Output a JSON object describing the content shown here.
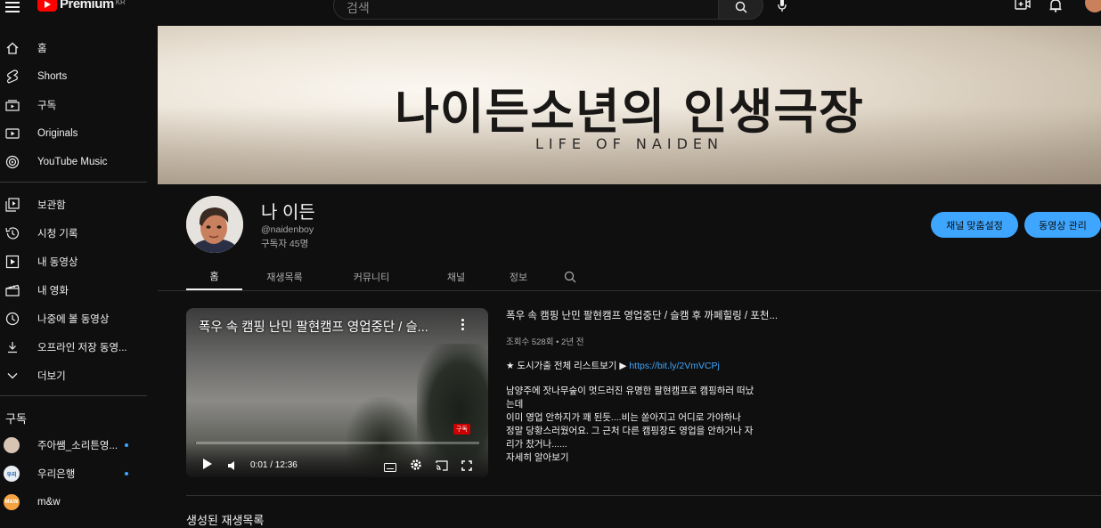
{
  "header": {
    "logo_text": "Premium",
    "logo_sup": "KR",
    "search_placeholder": "검색"
  },
  "sidebar": {
    "primary": [
      {
        "label": "홈",
        "icon": "home-icon"
      },
      {
        "label": "Shorts",
        "icon": "shorts-icon"
      },
      {
        "label": "구독",
        "icon": "subscriptions-icon"
      },
      {
        "label": "Originals",
        "icon": "originals-icon"
      },
      {
        "label": "YouTube Music",
        "icon": "music-icon"
      }
    ],
    "secondary": [
      {
        "label": "보관함",
        "icon": "library-icon"
      },
      {
        "label": "시청 기록",
        "icon": "history-icon"
      },
      {
        "label": "내 동영상",
        "icon": "my-videos-icon"
      },
      {
        "label": "내 영화",
        "icon": "movies-icon"
      },
      {
        "label": "나중에 볼 동영상",
        "icon": "watch-later-icon"
      },
      {
        "label": "오프라인 저장 동영...",
        "icon": "download-icon"
      },
      {
        "label": "더보기",
        "icon": "chevron-down-icon"
      }
    ],
    "subs_heading": "구독",
    "subscriptions": [
      {
        "label": "주아쌤_소리튼영...",
        "badge": "",
        "color": "#d8c4b2",
        "new": true
      },
      {
        "label": "우리은행",
        "badge": "우리",
        "color": "#e9eef5",
        "new": true
      },
      {
        "label": "m&w",
        "badge": "M&W",
        "color": "#f4a340",
        "new": false
      }
    ]
  },
  "banner": {
    "title": "나이든소년의 인생극장",
    "subtitle": "LIFE OF NAIDEN"
  },
  "channel": {
    "name": "나 이든",
    "handle": "@naidenboy",
    "subscribers": "구독자 45명",
    "customize_label": "채널 맞춤설정",
    "manage_label": "동영상 관리"
  },
  "tabs": [
    "홈",
    "재생목록",
    "커뮤니티",
    "채널",
    "정보"
  ],
  "featured": {
    "overlay_title": "폭우 속 캠핑 난민 팔현캠프 영업중단 / 슬...",
    "badge": "구독",
    "time": "0:01 / 12:36",
    "progress": 0.001,
    "title": "폭우 속 캠핑 난민 팔현캠프 영업중단 / 슬캠 후 까페힐링 / 포천...",
    "meta": "조회수 528회 • 2년 전",
    "link_prefix": "★ 도시가출  전체 리스트보기 ▶ ",
    "link": "https://bit.ly/2VmVCPj",
    "body_lines": [
      "남양주에 잣나무숲이 멋드러진 유명한 팔현캠프로 캠핑하러 떠났",
      "는데",
      "이미 영업 안하지가 꽤 된듯....비는 쏟아지고 어디로 가야하나",
      "정말 당황스러웠어요. 그 근처 다른 캠핑장도 영업을 안하거나 자",
      "리가 찼거나......"
    ],
    "more_label": "자세히 알아보기"
  },
  "section": {
    "title": "생성된 재생목록"
  }
}
